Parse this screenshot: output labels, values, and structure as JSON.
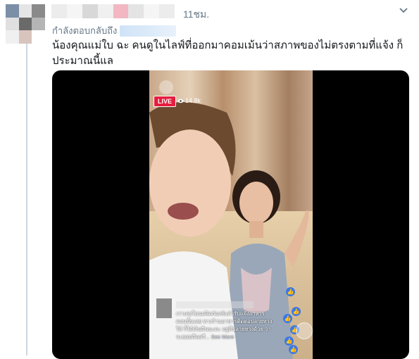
{
  "tweet": {
    "time": "11ชม.",
    "reply_prefix": "กำลังตอบกลับถึง",
    "text": "น้องคุณแม่ใบ ฉะ คนดูในไลฟ์ที่ออกมาคอมเม้นว่าสภาพของไม่ตรงตามที่แจ้ง ก็ประมาณนี้แล"
  },
  "video": {
    "live_label": "LIVE",
    "viewer_count": "14.8k",
    "comment_text": "เราเคยโอนผลิตภัณฑ์แล้วรับแจ้งอาหาร ตอนนั้นเลย ทางร้านอาหารติดต่อปลายทาง ให้ ก็ได้เงินคืนนะคะ อยู่ที่ปลายทางด้วย ว่าจะยอมคืนหรื...",
    "see_more": "See More"
  },
  "icons": {
    "menu": "chevron-down-icon",
    "views": "eye-icon",
    "reaction": "like-icon"
  },
  "colors": {
    "live_red": "#e41e3f",
    "reaction_blue": "#3b79e6",
    "meta_gray": "#657786"
  }
}
